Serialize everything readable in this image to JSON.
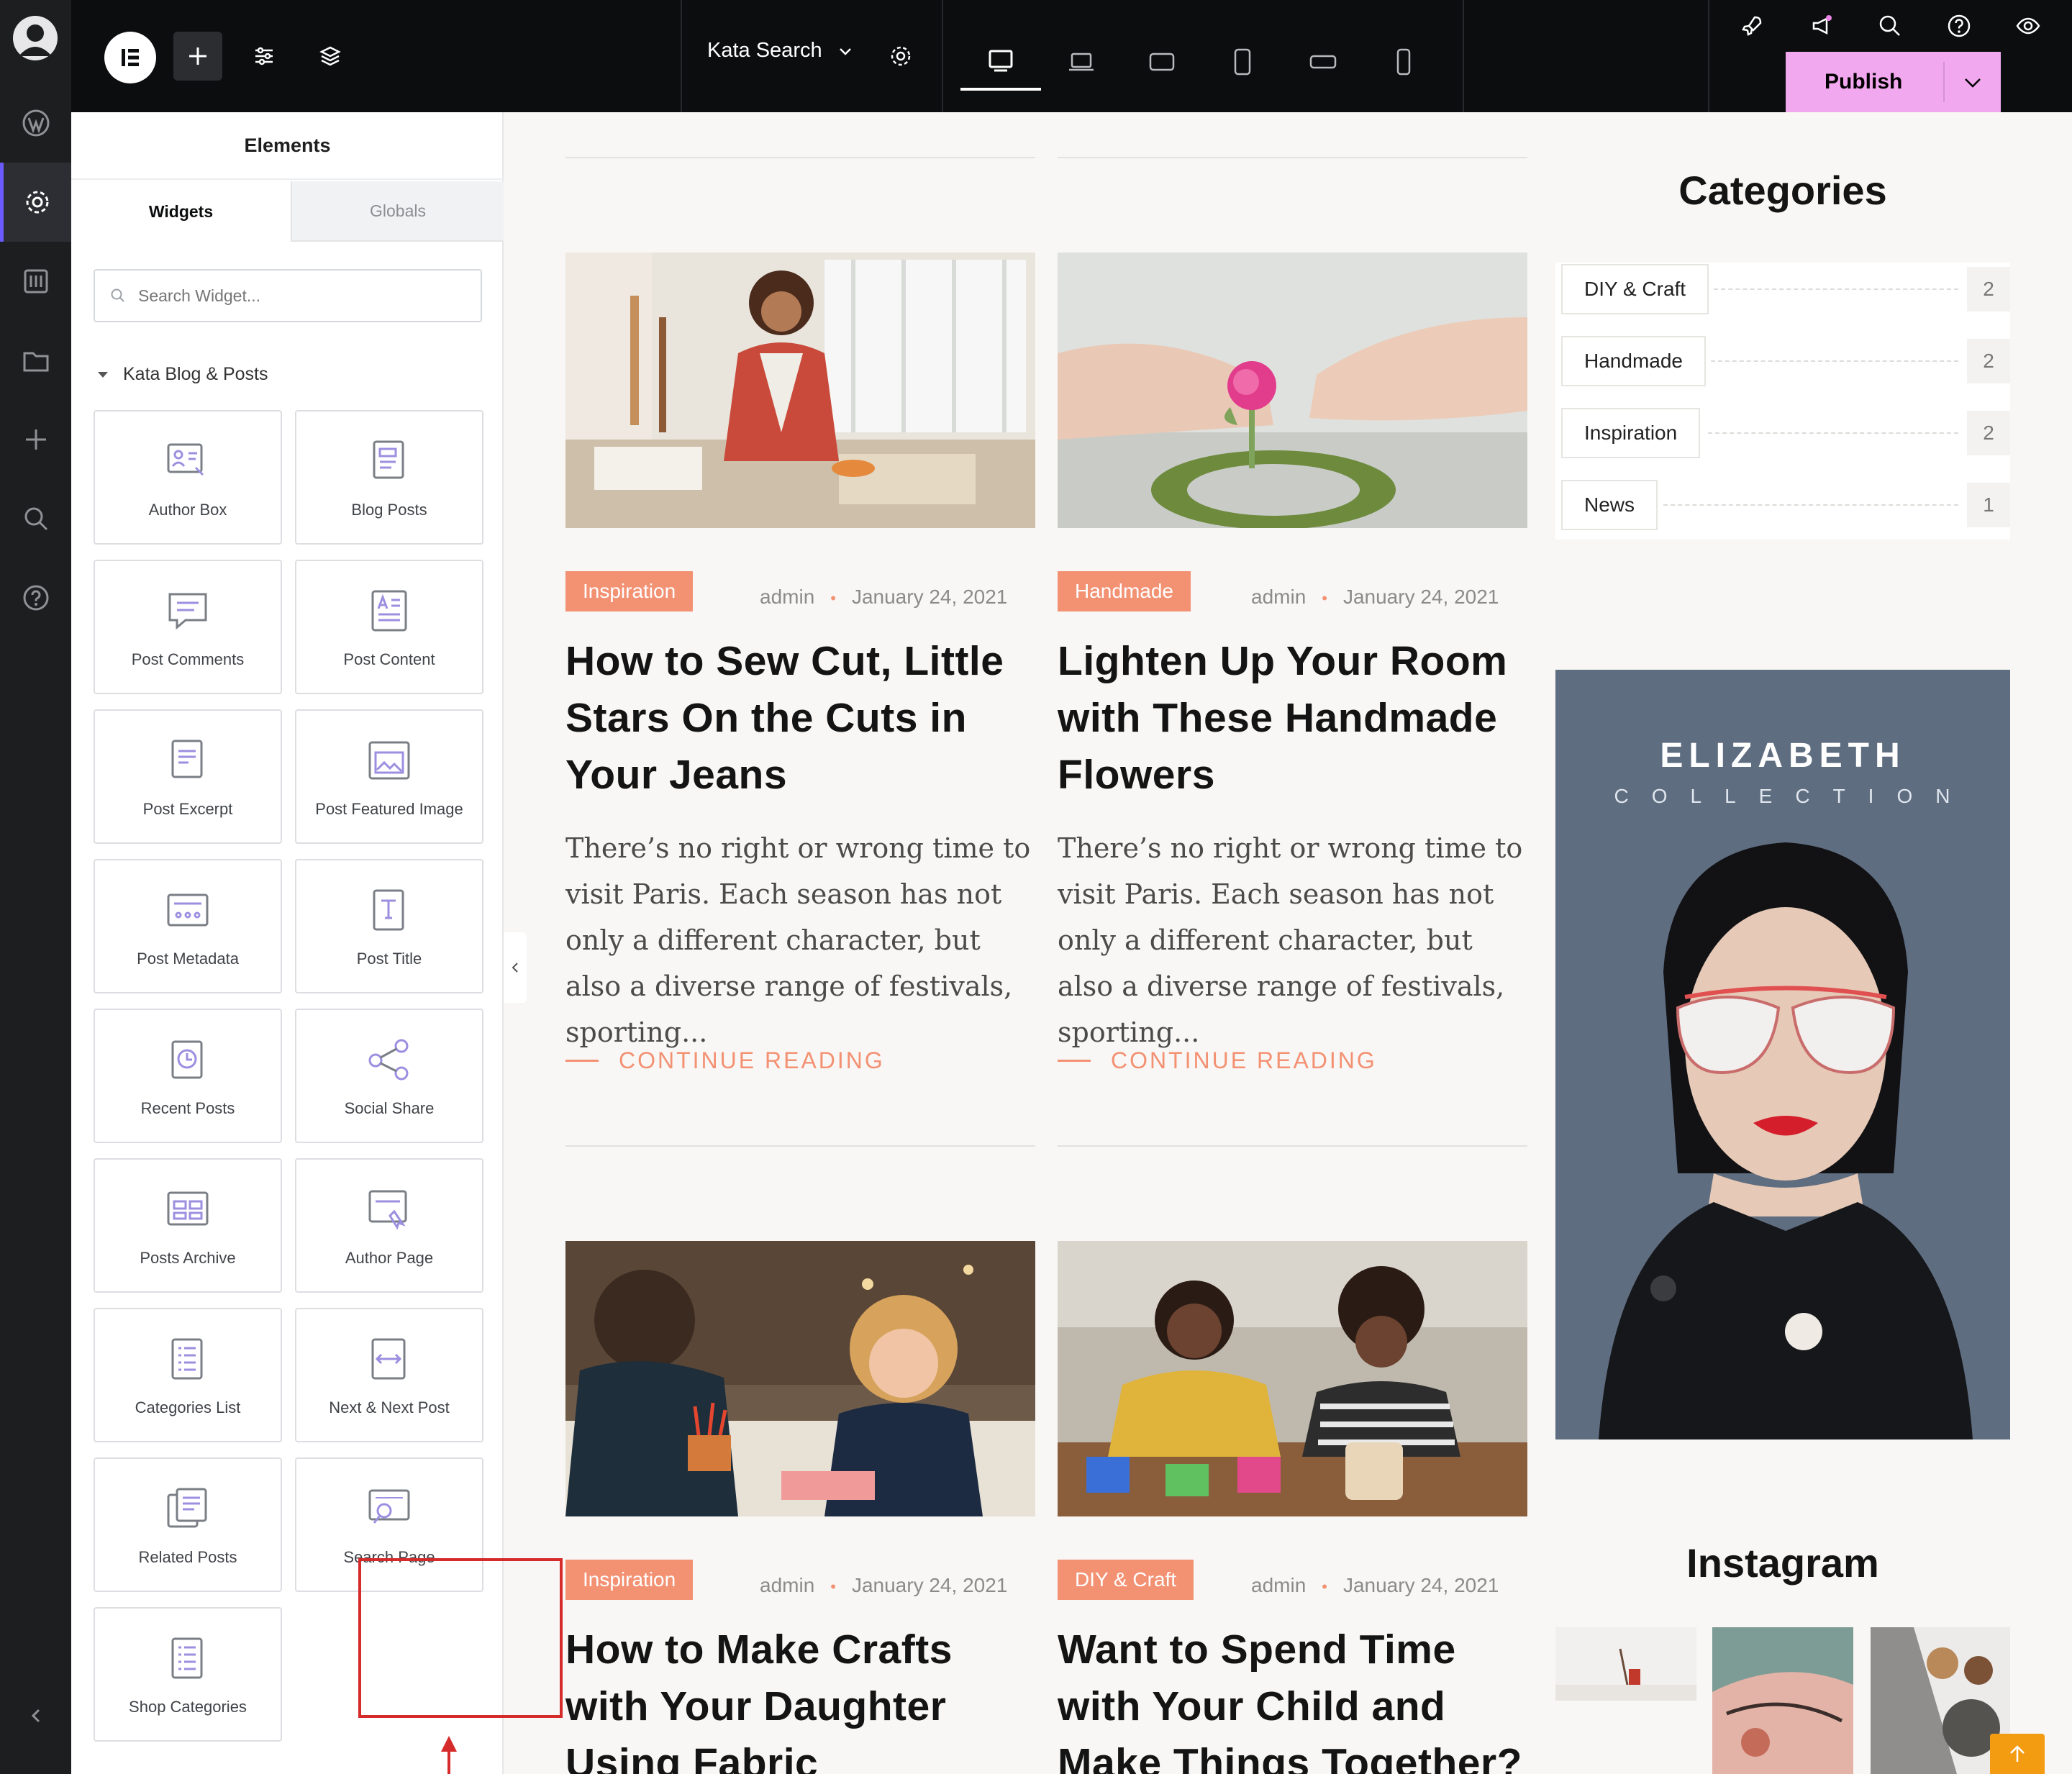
{
  "toolbar": {
    "document_title": "Kata Search",
    "publish_label": "Publish"
  },
  "panel": {
    "title": "Elements",
    "tabs": [
      "Widgets",
      "Globals"
    ],
    "search_placeholder": "Search Widget...",
    "category": "Kata Blog & Posts",
    "widgets": [
      {
        "label": "Author Box",
        "icon": "author-box-icon"
      },
      {
        "label": "Blog Posts",
        "icon": "blog-posts-icon"
      },
      {
        "label": "Post Comments",
        "icon": "post-comments-icon"
      },
      {
        "label": "Post Content",
        "icon": "post-content-icon"
      },
      {
        "label": "Post Excerpt",
        "icon": "post-excerpt-icon"
      },
      {
        "label": "Post Featured Image",
        "icon": "post-featured-image-icon"
      },
      {
        "label": "Post Metadata",
        "icon": "post-metadata-icon"
      },
      {
        "label": "Post Title",
        "icon": "post-title-icon"
      },
      {
        "label": "Recent Posts",
        "icon": "recent-posts-icon"
      },
      {
        "label": "Social Share",
        "icon": "social-share-icon"
      },
      {
        "label": "Posts Archive",
        "icon": "posts-archive-icon"
      },
      {
        "label": "Author Page",
        "icon": "author-page-icon"
      },
      {
        "label": "Categories List",
        "icon": "categories-list-icon"
      },
      {
        "label": "Next & Next Post",
        "icon": "next-post-icon"
      },
      {
        "label": "Related Posts",
        "icon": "related-posts-icon"
      },
      {
        "label": "Search Page",
        "icon": "search-page-icon"
      },
      {
        "label": "Shop Categories",
        "icon": "shop-categories-icon"
      }
    ]
  },
  "posts": [
    {
      "tag": "Inspiration",
      "author": "admin",
      "date": "January 24, 2021",
      "title": "How to Sew Cut, Little Stars On the Cuts in Your Jeans",
      "excerpt": "There’s no right or wrong time to visit Paris. Each season has not only a different character, but also a diverse range of festivals, sporting...",
      "more": "CONTINUE READING"
    },
    {
      "tag": "Handmade",
      "author": "admin",
      "date": "January 24, 2021",
      "title": "Lighten Up Your Room with These Handmade Flowers",
      "excerpt": "There’s no right or wrong time to visit Paris. Each season has not only a different character, but also a diverse range of festivals, sporting...",
      "more": "CONTINUE READING"
    },
    {
      "tag": "Inspiration",
      "author": "admin",
      "date": "January 24, 2021",
      "title": "How to Make Crafts with Your Daughter Using Fabric",
      "excerpt": "",
      "more": ""
    },
    {
      "tag": "DIY & Craft",
      "author": "admin",
      "date": "January 24, 2021",
      "title": "Want to Spend Time with Your Child and Make Things Together?",
      "excerpt": "",
      "more": ""
    }
  ],
  "sidebar": {
    "categories_title": "Categories",
    "categories": [
      {
        "name": "DIY & Craft",
        "count": "2"
      },
      {
        "name": "Handmade",
        "count": "2"
      },
      {
        "name": "Inspiration",
        "count": "2"
      },
      {
        "name": "News",
        "count": "1"
      }
    ],
    "ad_brand": "ELIZABETH",
    "ad_sub": "COLLECTION",
    "instagram_title": "Instagram"
  },
  "colors": {
    "accent": "#f39173",
    "publish": "#f2a8ef",
    "highlight": "#d62b2b",
    "rail": "#1d1e20",
    "topbar": "#0c0d0e"
  }
}
